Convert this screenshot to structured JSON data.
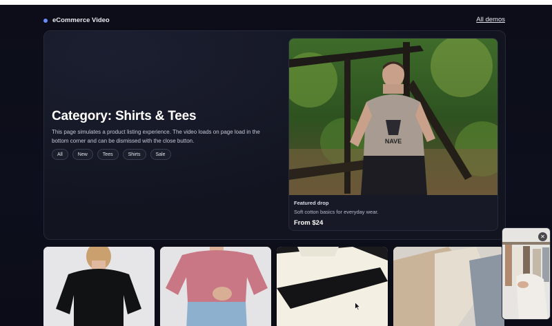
{
  "brand": {
    "name": "eCommerce Video"
  },
  "nav": {
    "all_demos": "All demos"
  },
  "hero": {
    "title": "Category: Shirts & Tees",
    "description": "This page simulates a product listing experience. The video loads on page load in the bottom corner and can be dismissed with the close button.",
    "chips": [
      "All",
      "New",
      "Tees",
      "Shirts",
      "Sale"
    ]
  },
  "featured": {
    "label": "Featured drop",
    "description": "Soft cotton basics for everyday wear.",
    "price": "From $24"
  },
  "video": {
    "close": "✕"
  },
  "colors": {
    "background": "#0c0d18",
    "card": "#121420",
    "accent": "#6b8cff",
    "text": "#e8eaf2"
  }
}
